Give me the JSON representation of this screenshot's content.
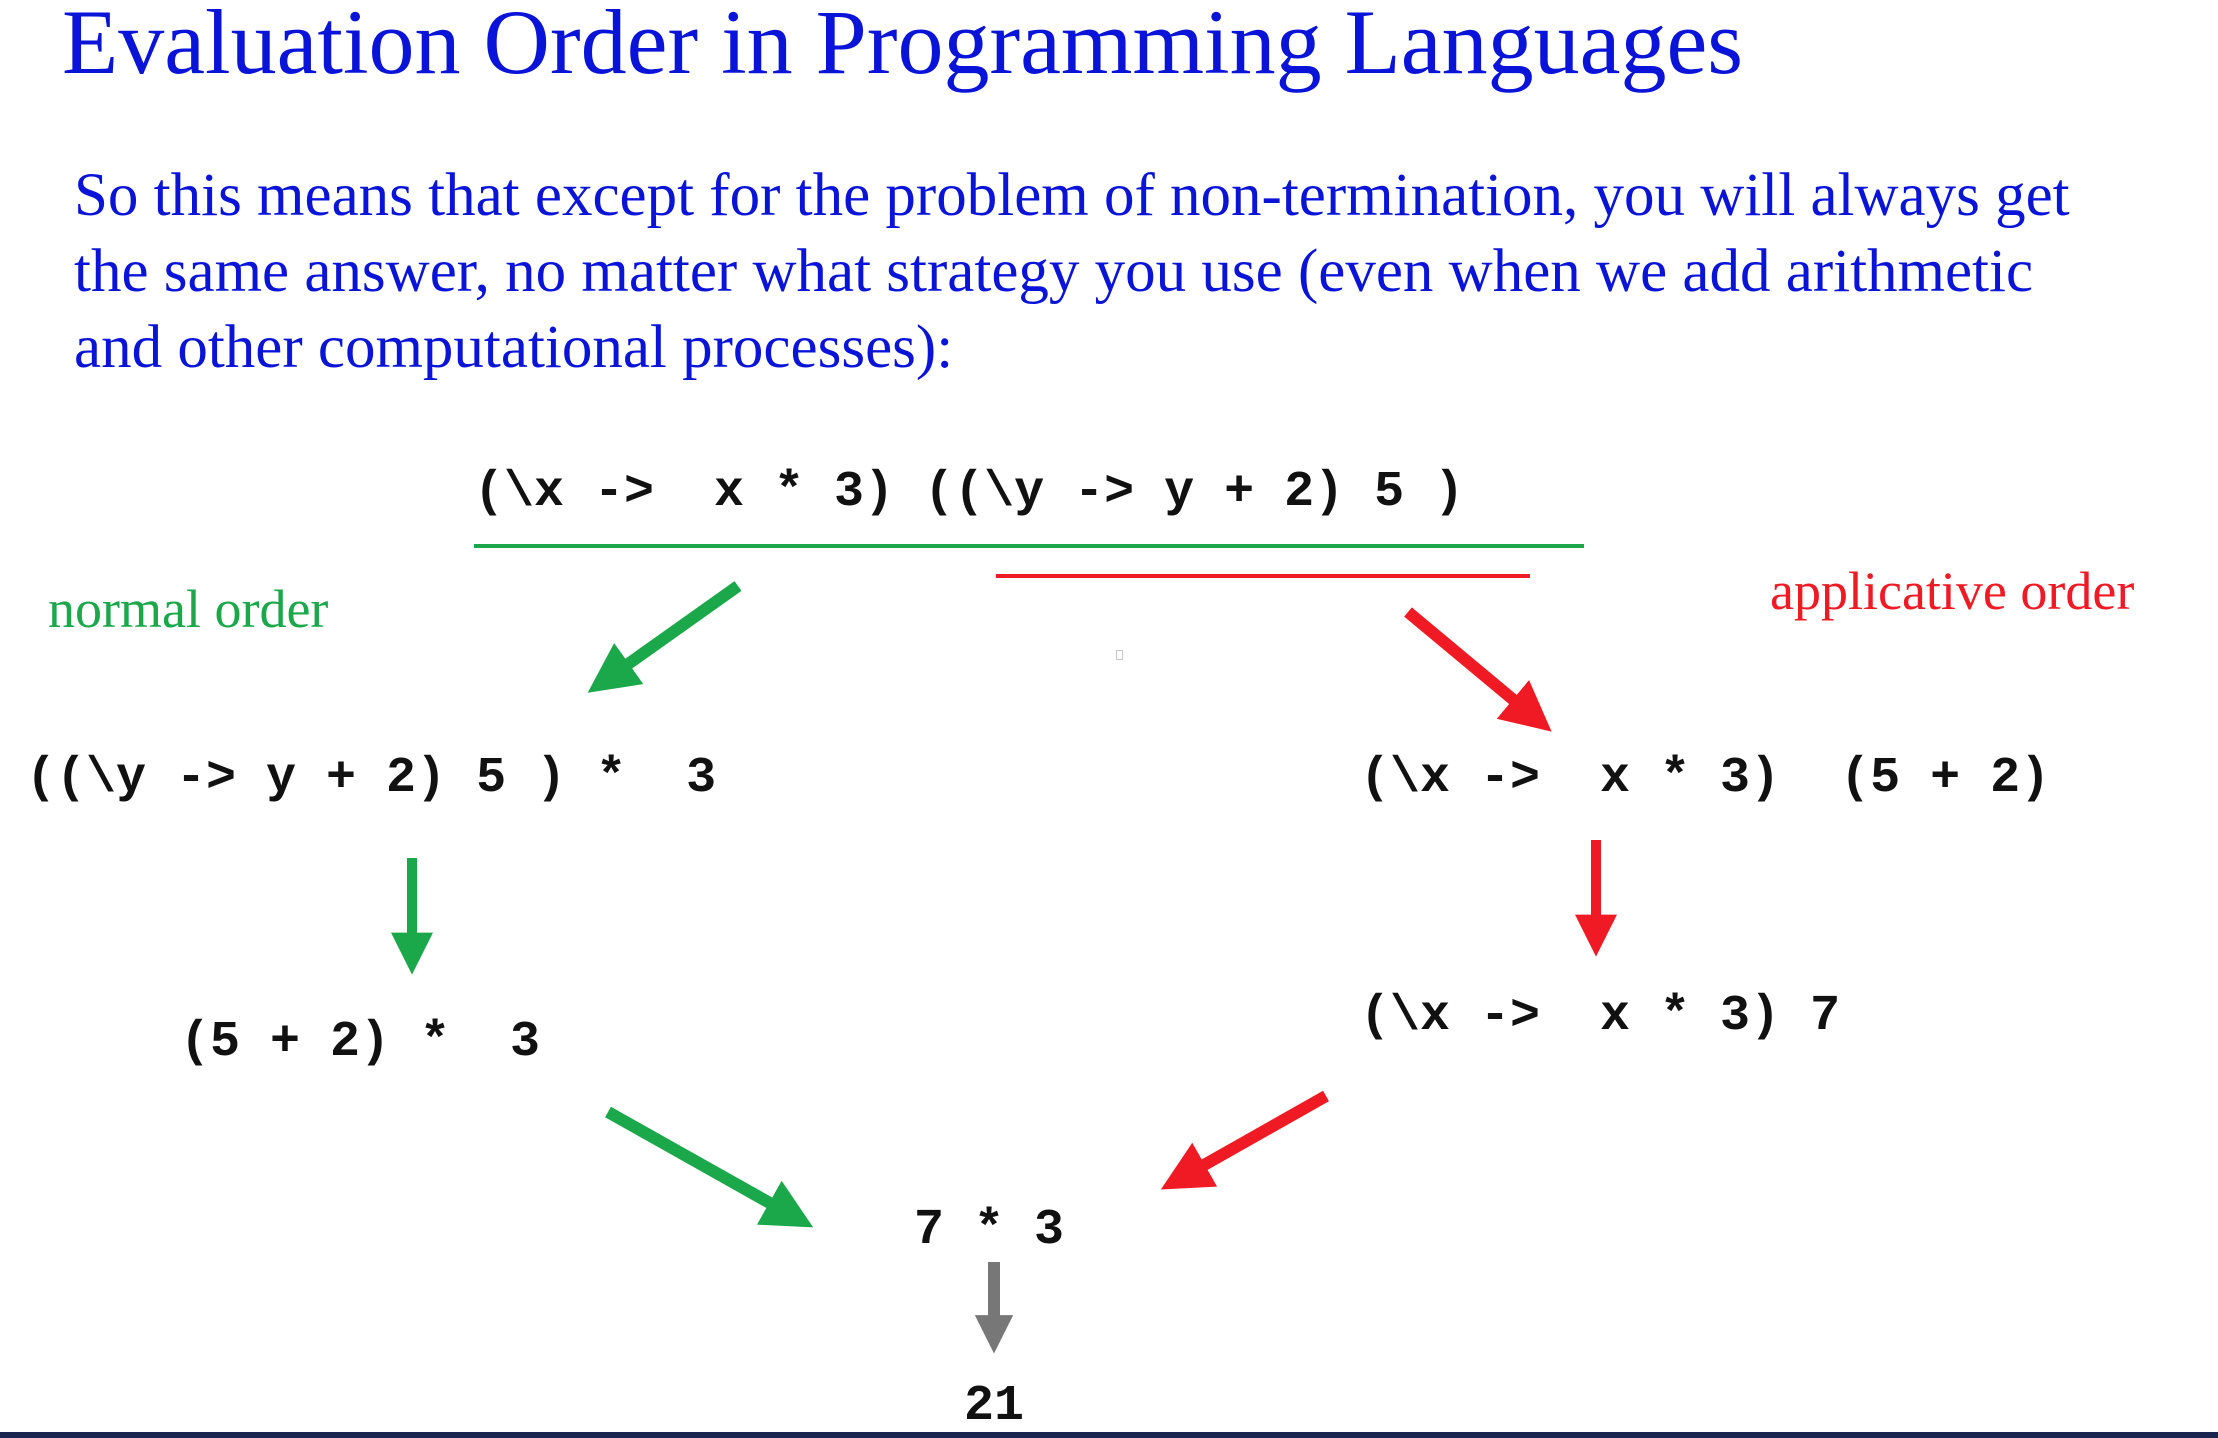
{
  "slide": {
    "title": "Evaluation Order in Programming Languages",
    "paragraph_lines": [
      "So this means that except for the problem of non-termination, you will always get",
      "the same answer, no matter what strategy you use (even when we add arithmetic",
      "and other computational processes):"
    ]
  },
  "diagram": {
    "colors": {
      "normal": "#1aa84a",
      "applicative": "#f01a24",
      "final": "#777777",
      "text": "#111111"
    },
    "labels": {
      "normal_order": "normal order",
      "applicative_order": "applicative order"
    },
    "expressions": {
      "start": "(\\x ->  x * 3) ((\\y -> y + 2) 5 )",
      "normal_step1": "((\\y -> y + 2) 5 ) *  3",
      "normal_step2": "(5 + 2) *  3",
      "applicative_step1": "(\\x ->  x * 3)  (5 + 2)",
      "applicative_step2": "(\\x ->  x * 3) 7",
      "converged": "7 * 3",
      "result": "21"
    }
  }
}
